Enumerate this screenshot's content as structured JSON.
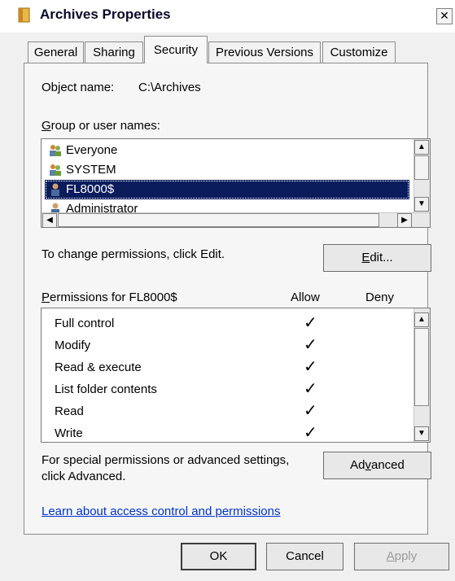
{
  "window": {
    "title": "Archives Properties",
    "close_glyph": "✕"
  },
  "tabs": [
    "General",
    "Sharing",
    "Security",
    "Previous Versions",
    "Customize"
  ],
  "active_tab": "Security",
  "object": {
    "label": "Object name:",
    "value": "C:\\Archives"
  },
  "group_label_first": "G",
  "group_label_rest": "roup or user names:",
  "users": [
    {
      "name": "Everyone",
      "icon": "group-icon",
      "selected": false
    },
    {
      "name": "SYSTEM",
      "icon": "group-icon",
      "selected": false
    },
    {
      "name": "FL8000$",
      "icon": "user-icon",
      "selected": true
    },
    {
      "name": "Administrator",
      "icon": "user-icon",
      "selected": false
    }
  ],
  "change_text": "To change permissions, click Edit.",
  "edit_button": {
    "first": "E",
    "rest": "dit..."
  },
  "permissions": {
    "label_first": "P",
    "label_rest": "ermissions for FL8000$",
    "allow_header": "Allow",
    "deny_header": "Deny",
    "check_glyph": "✓",
    "rows": [
      {
        "name": "Full control",
        "allow": true,
        "deny": false
      },
      {
        "name": "Modify",
        "allow": true,
        "deny": false
      },
      {
        "name": "Read & execute",
        "allow": true,
        "deny": false
      },
      {
        "name": "List folder contents",
        "allow": true,
        "deny": false
      },
      {
        "name": "Read",
        "allow": true,
        "deny": false
      },
      {
        "name": "Write",
        "allow": true,
        "deny": false
      }
    ]
  },
  "special_text_line1": "For special permissions or advanced settings,",
  "special_text_line2": "click Advanced.",
  "advanced_button": {
    "first": "Ad",
    "under": "v",
    "rest": "anced"
  },
  "learn_link": "Learn about access control and permissions",
  "footer_buttons": {
    "ok": "OK",
    "cancel": "Cancel",
    "apply_first": "A",
    "apply_rest": "pply"
  },
  "colors": {
    "selection": "#0b1c5c",
    "link": "#0033cc",
    "folder": "#e8b84a"
  }
}
